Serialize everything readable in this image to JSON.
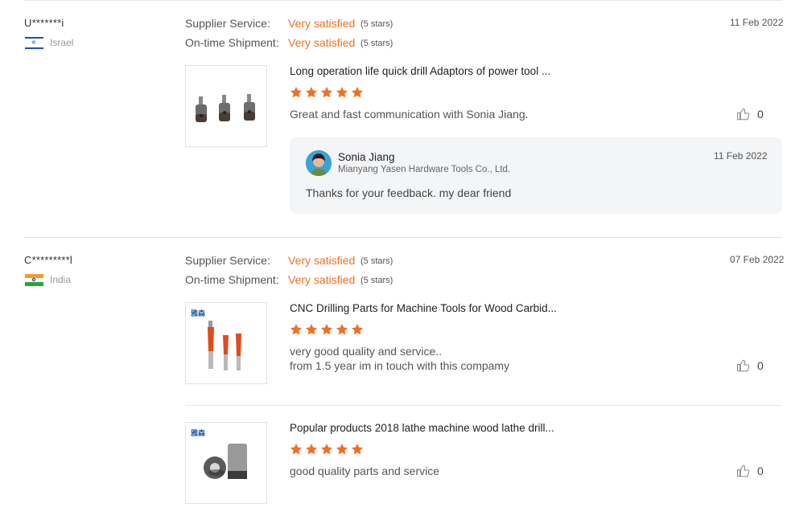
{
  "reviews": [
    {
      "user": "U*******i",
      "country": "Israel",
      "supplier_service_label": "Supplier Service:",
      "supplier_service_value": "Very satisfied",
      "supplier_service_stars": "(5 stars)",
      "shipment_label": "On-time Shipment:",
      "shipment_value": "Very satisfied",
      "shipment_stars": "(5 stars)",
      "date": "11 Feb 2022",
      "products": [
        {
          "title": "Long operation life quick drill Adaptors of power tool ...",
          "rating": 5,
          "comment": "Great and fast communication with Sonia Jiang.",
          "likes": "0"
        }
      ],
      "reply": {
        "name": "Sonia Jiang",
        "company": "Mianyang Yasen Hardware Tools Co., Ltd.",
        "date": "11 Feb 2022",
        "text": "Thanks for your feedback. my dear friend"
      }
    },
    {
      "user": "C*********l",
      "country": "India",
      "supplier_service_label": "Supplier Service:",
      "supplier_service_value": "Very satisfied",
      "supplier_service_stars": "(5 stars)",
      "shipment_label": "On-time Shipment:",
      "shipment_value": "Very satisfied",
      "shipment_stars": "(5 stars)",
      "date": "07 Feb 2022",
      "products": [
        {
          "title": "CNC Drilling Parts for Machine Tools for Wood Carbid...",
          "rating": 5,
          "comment": "very good quality and service..\nfrom 1.5 year im in touch with this compamy",
          "likes": "0",
          "logo": "雅森"
        },
        {
          "title": "Popular products 2018 lathe machine wood lathe drill...",
          "rating": 5,
          "comment": "good quality parts and service",
          "likes": "0",
          "logo": "雅森"
        }
      ]
    }
  ],
  "colors": {
    "accent": "#f36f21",
    "star": "#f36f21",
    "divider": "#e0e0e0",
    "reply_bg": "#f4f5f7"
  },
  "icons": {
    "star": "star-icon",
    "like": "thumbs-up-icon",
    "flag_il": "israel-flag-icon",
    "flag_in": "india-flag-icon"
  }
}
